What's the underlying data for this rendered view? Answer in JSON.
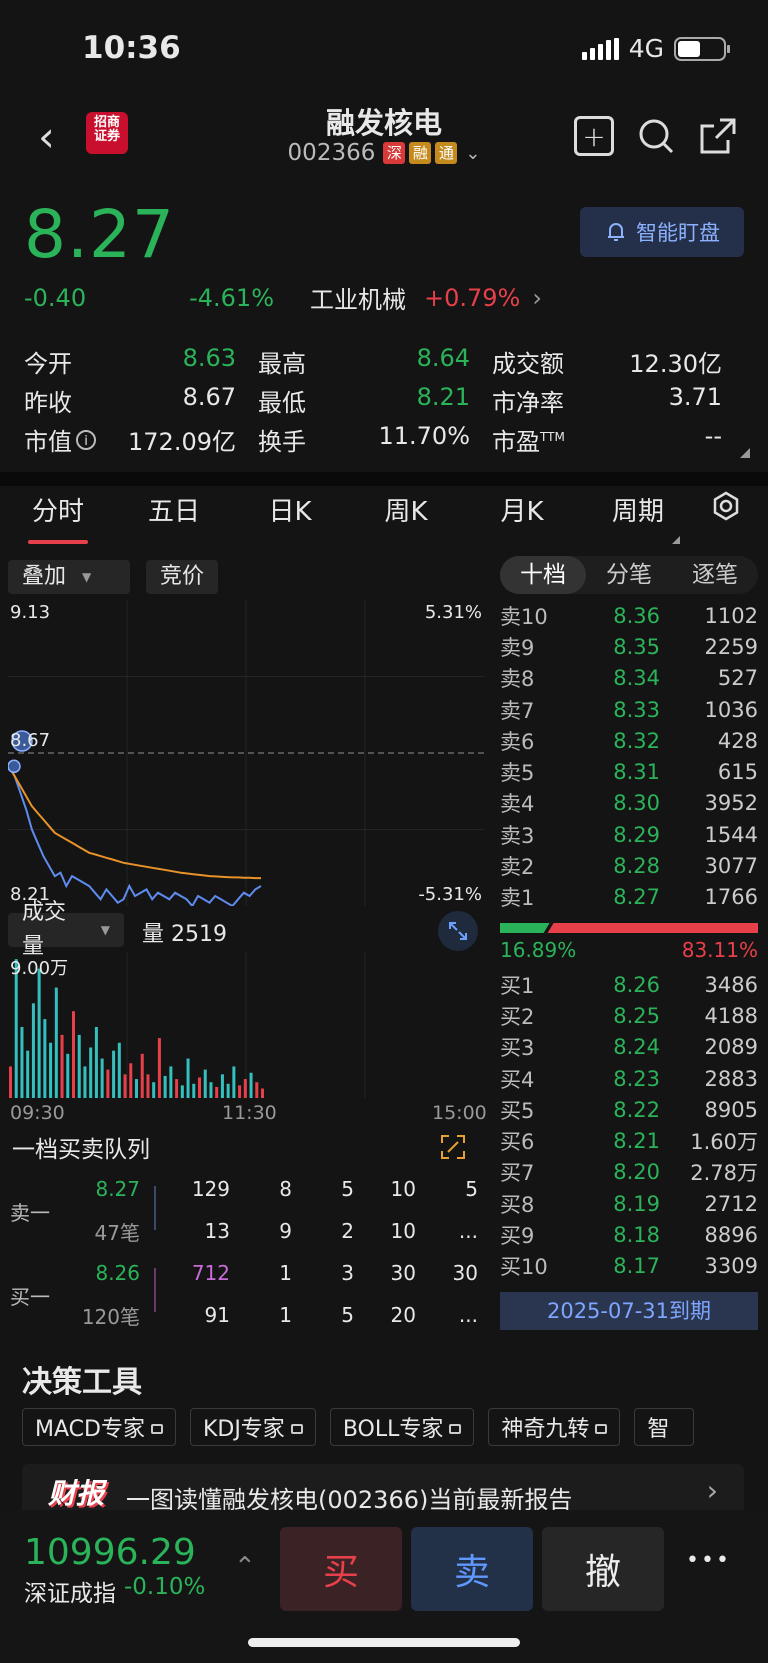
{
  "status_bar": {
    "time": "10:36",
    "network": "4G"
  },
  "header": {
    "logo_text": "招商\n证券",
    "title": "融发核电",
    "code": "002366",
    "tags": [
      {
        "text": "深",
        "color": "#d83a3a"
      },
      {
        "text": "融",
        "color": "#c58a1e"
      },
      {
        "text": "通",
        "color": "#c58a1e"
      }
    ]
  },
  "quote": {
    "price": "8.27",
    "change": "-0.40",
    "change_pct": "-4.61%",
    "sector": "工业机械",
    "sector_pct": "+0.79%",
    "alert_label": "智能盯盘"
  },
  "stats": [
    [
      {
        "label": "今开",
        "value": "8.63",
        "color": "green"
      },
      {
        "label": "最高",
        "value": "8.64",
        "color": "green"
      },
      {
        "label": "成交额",
        "value": "12.30亿",
        "color": "white"
      }
    ],
    [
      {
        "label": "昨收",
        "value": "8.67",
        "color": "white"
      },
      {
        "label": "最低",
        "value": "8.21",
        "color": "green"
      },
      {
        "label": "市净率",
        "value": "3.71",
        "color": "white"
      }
    ],
    [
      {
        "label": "市值",
        "value": "172.09亿",
        "color": "white"
      },
      {
        "label": "换手",
        "value": "11.70%",
        "color": "white"
      },
      {
        "label": "市盈",
        "sup": "TTM",
        "value": "--",
        "color": "white"
      }
    ]
  ],
  "tabs": [
    "分时",
    "五日",
    "日K",
    "周K",
    "月K",
    "周期"
  ],
  "chart_controls": {
    "overlay": "叠加",
    "auction": "竞价",
    "volume_label": "成交量",
    "volume_value": "量 2519"
  },
  "chart_data": {
    "type": "line",
    "y_left_labels": [
      "9.13",
      "8.67",
      "8.21"
    ],
    "y_right_labels": [
      "5.31%",
      "-5.31%"
    ],
    "x_labels": [
      "09:30",
      "11:30",
      "15:00"
    ],
    "ylim": [
      8.21,
      9.13
    ],
    "prev_close": 8.67,
    "volume_max_label": "9.00万",
    "volume_ylim": [
      0,
      90000
    ],
    "series": [
      {
        "values": [
          8.63,
          8.6,
          8.55,
          8.5,
          8.44,
          8.4,
          8.36,
          8.33,
          8.3,
          8.31,
          8.27,
          8.3,
          8.29,
          8.28,
          8.27,
          8.25,
          8.23,
          8.26,
          8.24,
          8.22,
          8.23,
          8.27,
          8.24,
          8.25,
          8.26,
          8.23,
          8.25,
          8.24,
          8.23,
          8.25,
          8.24,
          8.23,
          8.21,
          8.24,
          8.23,
          8.22,
          8.24,
          8.23,
          8.22,
          8.21,
          8.23,
          8.25,
          8.24,
          8.26,
          8.27
        ]
      },
      {
        "values": [
          8.63,
          8.6,
          8.57,
          8.54,
          8.51,
          8.49,
          8.47,
          8.45,
          8.43,
          8.42,
          8.41,
          8.4,
          8.39,
          8.38,
          8.37,
          8.365,
          8.36,
          8.355,
          8.35,
          8.345,
          8.34,
          8.337,
          8.334,
          8.331,
          8.328,
          8.325,
          8.322,
          8.319,
          8.316,
          8.313,
          8.31,
          8.308,
          8.306,
          8.304,
          8.302,
          8.3,
          8.299,
          8.298,
          8.297,
          8.296,
          8.296,
          8.295,
          8.295,
          8.294,
          8.294
        ]
      }
    ],
    "volume": [
      20000,
      88000,
      45000,
      30000,
      60000,
      82000,
      50000,
      35000,
      70000,
      40000,
      28000,
      55000,
      40000,
      20000,
      32000,
      45000,
      25000,
      18000,
      30000,
      35000,
      15000,
      22000,
      12000,
      28000,
      15000,
      10000,
      38000,
      14000,
      20000,
      12000,
      8000,
      25000,
      9000,
      13000,
      18000,
      10000,
      7000,
      15000,
      9000,
      20000,
      8000,
      12000,
      16000,
      10000,
      6000
    ]
  },
  "order_book": {
    "tabs": [
      "十档",
      "分笔",
      "逐笔"
    ],
    "asks": [
      {
        "label": "卖10",
        "price": "8.36",
        "vol": "1102"
      },
      {
        "label": "卖9",
        "price": "8.35",
        "vol": "2259"
      },
      {
        "label": "卖8",
        "price": "8.34",
        "vol": "527"
      },
      {
        "label": "卖7",
        "price": "8.33",
        "vol": "1036"
      },
      {
        "label": "卖6",
        "price": "8.32",
        "vol": "428"
      },
      {
        "label": "卖5",
        "price": "8.31",
        "vol": "615"
      },
      {
        "label": "卖4",
        "price": "8.30",
        "vol": "3952"
      },
      {
        "label": "卖3",
        "price": "8.29",
        "vol": "1544"
      },
      {
        "label": "卖2",
        "price": "8.28",
        "vol": "3077"
      },
      {
        "label": "卖1",
        "price": "8.27",
        "vol": "1766"
      }
    ],
    "buy_pct": "16.89%",
    "sell_pct": "83.11%",
    "buy_ratio": 0.1689,
    "bids": [
      {
        "label": "买1",
        "price": "8.26",
        "vol": "3486"
      },
      {
        "label": "买2",
        "price": "8.25",
        "vol": "4188"
      },
      {
        "label": "买3",
        "price": "8.24",
        "vol": "2089"
      },
      {
        "label": "买4",
        "price": "8.23",
        "vol": "2883"
      },
      {
        "label": "买5",
        "price": "8.22",
        "vol": "8905"
      },
      {
        "label": "买6",
        "price": "8.21",
        "vol": "1.60万"
      },
      {
        "label": "买7",
        "price": "8.20",
        "vol": "2.78万"
      },
      {
        "label": "买8",
        "price": "8.19",
        "vol": "2712"
      },
      {
        "label": "买9",
        "price": "8.18",
        "vol": "8896"
      },
      {
        "label": "买10",
        "price": "8.17",
        "vol": "3309"
      }
    ],
    "expiry": "2025-07-31到期"
  },
  "queue": {
    "title": "一档买卖队列",
    "sell_label": "卖一",
    "buy_label": "买一",
    "sell_price": "8.27",
    "sell_count": "47笔",
    "sell_row1": [
      "129",
      "8",
      "5",
      "10",
      "5"
    ],
    "sell_row2": [
      "13",
      "9",
      "2",
      "10",
      "..."
    ],
    "buy_price": "8.26",
    "buy_count": "120笔",
    "buy_row1": [
      "712",
      "1",
      "3",
      "30",
      "30"
    ],
    "buy_row2": [
      "91",
      "1",
      "5",
      "20",
      "..."
    ]
  },
  "tools": {
    "title": "决策工具",
    "items": [
      "MACD专家",
      "KDJ专家",
      "BOLL专家",
      "神奇九转",
      "智"
    ]
  },
  "news": {
    "badge": "财报",
    "text": "一图读懂融发核电(002366)当前最新报告"
  },
  "bottom": {
    "index_value": "10996.29",
    "index_name": "深证成指",
    "index_pct": "-0.10%",
    "buy": "买",
    "sell": "卖",
    "cancel": "撤",
    "more": "•••"
  }
}
